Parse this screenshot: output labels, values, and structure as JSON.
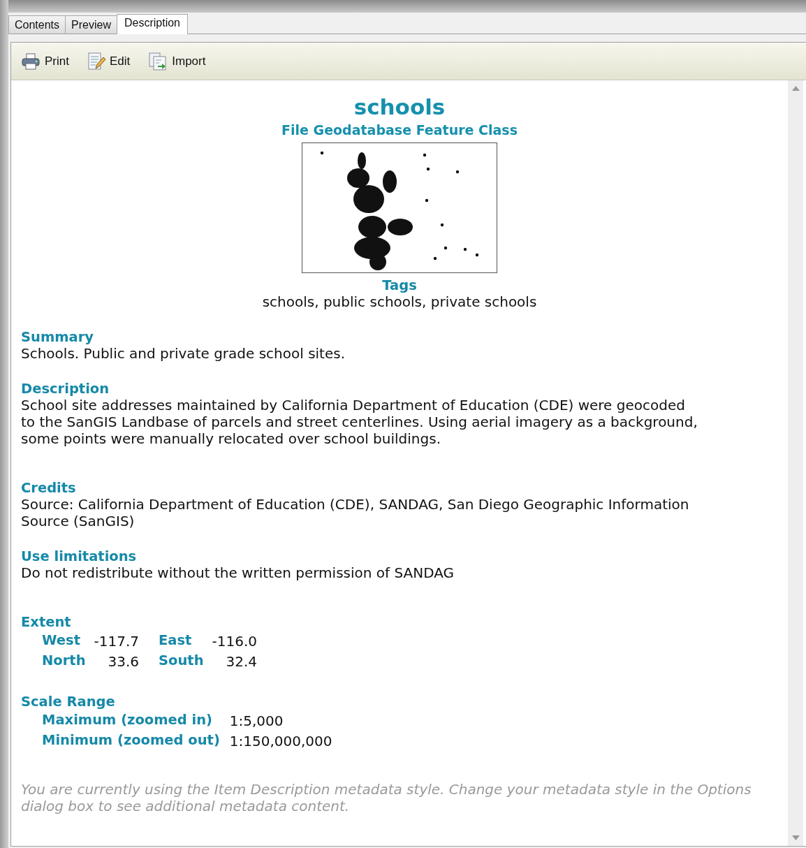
{
  "tabs": [
    {
      "label": "Contents",
      "selected": false
    },
    {
      "label": "Preview",
      "selected": false
    },
    {
      "label": "Description",
      "selected": true
    }
  ],
  "toolbar": [
    {
      "kind": "print",
      "label": "Print"
    },
    {
      "kind": "edit",
      "label": "Edit"
    },
    {
      "kind": "import",
      "label": "Import"
    }
  ],
  "item": {
    "title": "schools",
    "type": "File Geodatabase Feature Class",
    "tags_heading": "Tags",
    "tags": "schools, public schools, private schools"
  },
  "sections": [
    {
      "kind": "text",
      "heading": "Summary",
      "text": "Schools. Public and private grade school sites."
    },
    {
      "kind": "text",
      "heading": "Description",
      "text": "School site addresses maintained by California Department of Education (CDE) were geocoded to the SanGIS Landbase of parcels and street centerlines. Using aerial imagery as a background, some points were manually relocated over school buildings."
    },
    {
      "kind": "text",
      "heading": "Credits",
      "text": "Source: California Department of Education (CDE), SANDAG, San Diego Geographic Information Source (SanGIS)"
    },
    {
      "kind": "text",
      "heading": "Use limitations",
      "text": "Do not redistribute without the written permission of SANDAG"
    },
    {
      "kind": "extent",
      "heading": "Extent",
      "rows": [
        [
          {
            "label": "West",
            "value": "-117.7"
          },
          {
            "label": "East",
            "value": "-116.0"
          }
        ],
        [
          {
            "label": "North",
            "value": "33.6"
          },
          {
            "label": "South",
            "value": "32.4"
          }
        ]
      ]
    },
    {
      "kind": "scale",
      "heading": "Scale Range",
      "rows": [
        {
          "label": "Maximum (zoomed in)",
          "value": "1:5,000"
        },
        {
          "label": "Minimum (zoomed out)",
          "value": "1:150,000,000"
        }
      ]
    }
  ],
  "footer_note": "You are currently using the Item Description metadata style. Change your metadata style in the Options dialog box to see additional metadata content."
}
